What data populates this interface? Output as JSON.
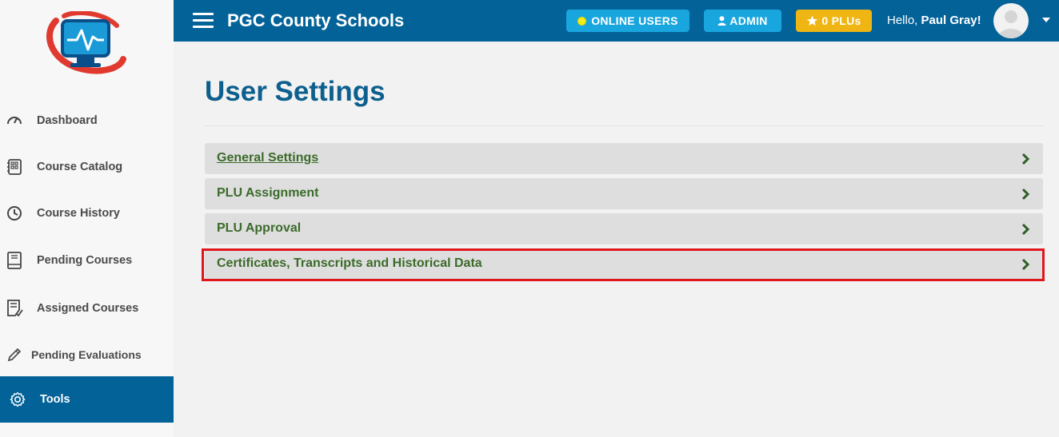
{
  "header": {
    "site_title": "PGC County Schools",
    "online_users": "ONLINE USERS",
    "admin": "ADMIN",
    "plus": "0 PLUs",
    "greeting_prefix": "Hello, ",
    "greeting_name": "Paul Gray!"
  },
  "sidebar": {
    "items": [
      {
        "label": "Dashboard",
        "icon": "gauge-icon"
      },
      {
        "label": "Course Catalog",
        "icon": "catalog-icon"
      },
      {
        "label": "Course History",
        "icon": "clock-icon"
      },
      {
        "label": "Pending Courses",
        "icon": "book-icon"
      },
      {
        "label": "Assigned Courses",
        "icon": "checklist-icon"
      },
      {
        "label": "Pending Evaluations",
        "icon": "pencil-icon"
      },
      {
        "label": "Tools",
        "icon": "gear-icon",
        "active": true
      }
    ]
  },
  "main": {
    "title": "User Settings",
    "panels": [
      {
        "label": "General Settings",
        "link": true
      },
      {
        "label": "PLU Assignment"
      },
      {
        "label": "PLU Approval"
      },
      {
        "label": "Certificates, Transcripts and Historical Data",
        "highlighted": true
      }
    ]
  },
  "colors": {
    "header_bg": "#036399",
    "accent_blue": "#19a6de",
    "plu_gold": "#efb513",
    "panel_text_green": "#3b6b29",
    "title_blue": "#0d5f8e",
    "highlight_red": "#e0161d"
  }
}
